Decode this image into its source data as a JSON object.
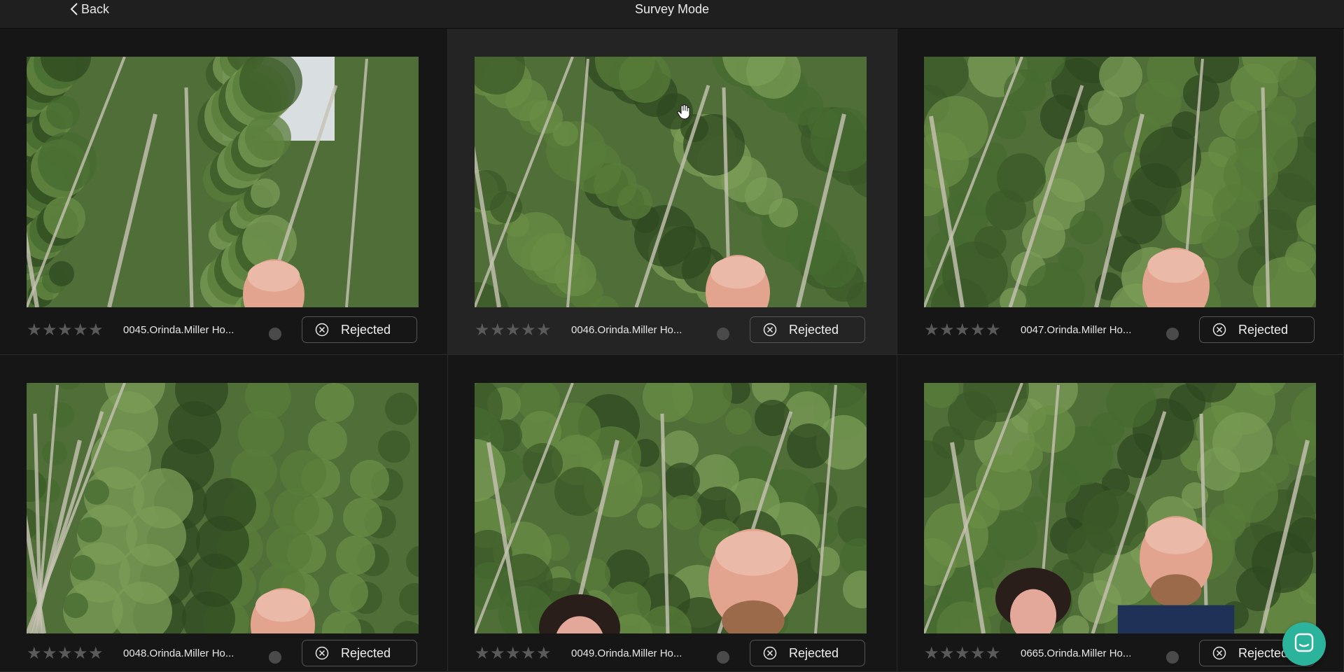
{
  "header": {
    "back_label": "Back",
    "title": "Survey Mode"
  },
  "icons": {
    "back": "chevron-left-icon",
    "star": "star-icon",
    "reject": "circle-x-icon",
    "chat": "chat-icon",
    "cursor": "hand-cursor-icon"
  },
  "colors": {
    "background": "#141414",
    "topbar": "#1f1f1f",
    "active_cell": "#242424",
    "chat_accent": "#2bb39c",
    "star_inactive": "#5a5a5a"
  },
  "photos": [
    {
      "filename": "0045.Orinda.Miller Ho...",
      "rating": 0,
      "status": "Rejected",
      "selected": false
    },
    {
      "filename": "0046.Orinda.Miller Ho...",
      "rating": 0,
      "status": "Rejected",
      "selected": true
    },
    {
      "filename": "0047.Orinda.Miller Ho...",
      "rating": 0,
      "status": "Rejected",
      "selected": false
    },
    {
      "filename": "0048.Orinda.Miller Ho...",
      "rating": 0,
      "status": "Rejected",
      "selected": false
    },
    {
      "filename": "0049.Orinda.Miller Ho...",
      "rating": 0,
      "status": "Rejected",
      "selected": false
    },
    {
      "filename": "0665.Orinda.Miller Ho...",
      "rating": 0,
      "status": "Rejected",
      "selected": false
    }
  ]
}
